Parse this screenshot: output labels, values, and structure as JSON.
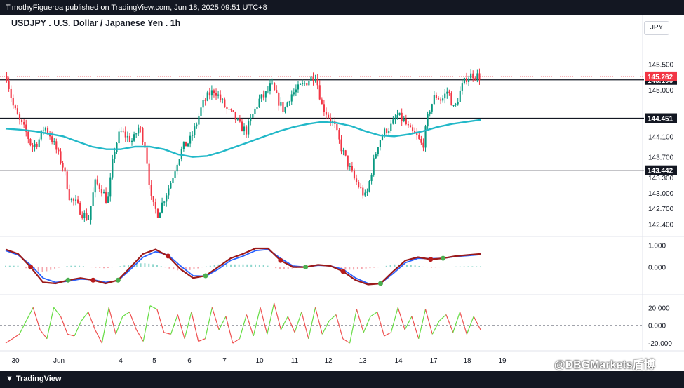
{
  "header": {
    "publish_line": "TimothyFigueroa published on TradingView.com, Jun 18, 2025 09:51 UTC+8"
  },
  "footer": {
    "logo_text": "TradingView",
    "watermark": "@DBGMarkets盾博"
  },
  "chart_data": {
    "type": "candlestick",
    "title": "USDJPY . U.S. Dollar / Japanese Yen . 1h",
    "currency": "JPY",
    "price_axis": {
      "range": [
        142.2,
        145.9
      ],
      "ticks": [
        "145.500",
        "145.000",
        "144.100",
        "143.700",
        "143.300",
        "143.000",
        "142.700",
        "142.400"
      ],
      "tick_values": [
        145.5,
        145.0,
        144.1,
        143.7,
        143.3,
        143.0,
        142.7,
        142.4
      ]
    },
    "horizontal_levels": [
      {
        "value": 145.196,
        "label": "145.196"
      },
      {
        "value": 144.451,
        "label": "144.451"
      },
      {
        "value": 143.442,
        "label": "143.442"
      }
    ],
    "last_price": {
      "value": 145.262,
      "label": "145.262"
    },
    "x_labels": [
      "30",
      "Jun",
      "4",
      "5",
      "6",
      "7",
      "10",
      "11",
      "12",
      "13",
      "14",
      "17",
      "18",
      "19"
    ],
    "close_path": [
      145.26,
      144.7,
      144.4,
      144.2,
      143.9,
      144.0,
      144.3,
      144.1,
      143.8,
      143.5,
      142.9,
      142.8,
      142.6,
      142.5,
      143.2,
      143.1,
      142.8,
      143.8,
      144.2,
      144.1,
      144.0,
      144.3,
      143.9,
      142.8,
      142.6,
      142.9,
      143.2,
      143.6,
      143.9,
      144.0,
      144.3,
      144.7,
      144.9,
      145.0,
      144.8,
      144.6,
      144.5,
      144.3,
      144.2,
      144.5,
      144.8,
      144.9,
      145.1,
      144.8,
      144.6,
      144.9,
      145.0,
      145.1,
      145.2,
      145.3,
      144.7,
      144.5,
      144.3,
      143.9,
      143.6,
      143.3,
      143.1,
      142.9,
      143.5,
      144.0,
      144.2,
      144.3,
      144.5,
      144.4,
      144.2,
      144.1,
      143.9,
      144.6,
      144.9,
      144.8,
      145.0,
      144.6,
      145.0,
      145.25,
      145.3,
      145.26
    ],
    "sma_path": [
      144.25,
      144.23,
      144.2,
      144.15,
      144.1,
      144.0,
      143.9,
      143.85,
      143.85,
      143.9,
      143.9,
      143.85,
      143.75,
      143.7,
      143.72,
      143.8,
      143.9,
      144.0,
      144.1,
      144.2,
      144.28,
      144.34,
      144.38,
      144.36,
      144.3,
      144.2,
      144.12,
      144.1,
      144.14,
      144.2,
      144.28,
      144.34,
      144.38,
      144.42
    ],
    "oscillator_1": {
      "range": [
        -1.2,
        1.3
      ],
      "ticks": [
        "1.000",
        "0.000"
      ],
      "tick_values": [
        1.0,
        0.0
      ],
      "fast": [
        0.8,
        0.6,
        0.0,
        -0.7,
        -0.75,
        -0.6,
        -0.5,
        -0.6,
        -0.75,
        -0.6,
        0.0,
        0.6,
        0.8,
        0.5,
        -0.1,
        -0.5,
        -0.4,
        0.0,
        0.4,
        0.6,
        0.85,
        0.85,
        0.3,
        0.0,
        0.0,
        0.1,
        0.05,
        -0.2,
        -0.6,
        -0.8,
        -0.75,
        -0.2,
        0.3,
        0.45,
        0.35,
        0.4,
        0.5,
        0.55,
        0.6
      ],
      "slow": [
        0.75,
        0.55,
        0.1,
        -0.5,
        -0.7,
        -0.65,
        -0.55,
        -0.58,
        -0.7,
        -0.62,
        -0.1,
        0.45,
        0.7,
        0.55,
        0.05,
        -0.4,
        -0.42,
        -0.1,
        0.3,
        0.5,
        0.75,
        0.8,
        0.4,
        0.05,
        0.0,
        0.08,
        0.05,
        -0.1,
        -0.5,
        -0.75,
        -0.75,
        -0.3,
        0.2,
        0.4,
        0.38,
        0.4,
        0.48,
        0.52,
        0.57
      ]
    },
    "oscillator_2": {
      "range": [
        -27,
        32
      ],
      "ticks": [
        "20.000",
        "0.000",
        "-20.000"
      ],
      "tick_values": [
        20,
        0,
        -20
      ],
      "values": [
        -20,
        -15,
        -10,
        5,
        20,
        -5,
        -15,
        20,
        10,
        -10,
        -12,
        5,
        15,
        -5,
        -20,
        20,
        -10,
        10,
        15,
        -5,
        -18,
        22,
        18,
        -8,
        -10,
        12,
        -15,
        15,
        -18,
        -15,
        20,
        -5,
        10,
        -20,
        -15,
        12,
        -12,
        20,
        -10,
        25,
        -5,
        10,
        -8,
        15,
        -15,
        20,
        -10,
        5,
        12,
        -15,
        -20,
        18,
        -8,
        10,
        15,
        -12,
        -8,
        20,
        -5,
        10,
        -15,
        18,
        -10,
        5,
        12,
        -8,
        15,
        -10,
        10,
        -5
      ]
    }
  }
}
